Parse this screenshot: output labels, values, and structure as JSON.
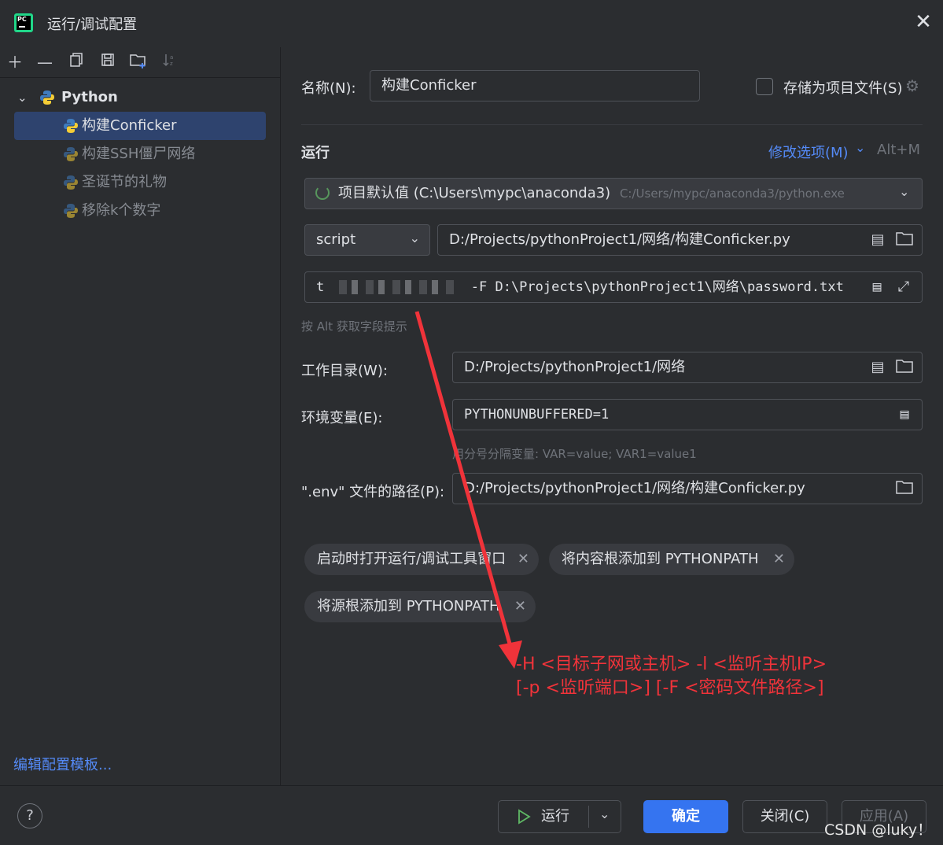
{
  "window": {
    "title": "运行/调试配置"
  },
  "tree": {
    "group": "Python",
    "items": [
      "构建Conficker",
      "构建SSH僵尸网络",
      "圣诞节的礼物",
      "移除k个数字"
    ]
  },
  "left_footer": {
    "edit_templates": "编辑配置模板..."
  },
  "form": {
    "name_label": "名称(N):",
    "name_value": "构建Conficker",
    "store_label": "存储为项目文件(S)",
    "run_section": "运行",
    "modify_options": "修改选项(M)",
    "modify_shortcut": "Alt+M",
    "interpreter_main": "项目默认值 (C:\\Users\\mypc\\anaconda3)",
    "interpreter_path": "C:/Users/mypc/anaconda3/python.exe",
    "script_type": "script",
    "script_path": "D:/Projects/pythonProject1/网络/构建Conficker.py",
    "params_prefix": "t",
    "params_value": "-F D:\\Projects\\pythonProject1\\网络\\password.txt",
    "alt_hint": "按 Alt 获取字段提示",
    "workdir_label": "工作目录(W):",
    "workdir_value": "D:/Projects/pythonProject1/网络",
    "env_label": "环境变量(E):",
    "env_value": "PYTHONUNBUFFERED=1",
    "env_hint": "用分号分隔变量: VAR=value; VAR1=value1",
    "dotenv_label": "\".env\" 文件的路径(P):",
    "dotenv_value": "D:/Projects/pythonProject1/网络/构建Conficker.py",
    "chips": [
      "启动时打开运行/调试工具窗口",
      "将内容根添加到 PYTHONPATH",
      "将源根添加到 PYTHONPATH"
    ]
  },
  "annotation": {
    "line1": "-H <目标子网或主机> -l <监听主机IP>",
    "line2": "[-p <监听端口>] [-F <密码文件路径>]",
    "color": "#f0333a"
  },
  "buttons": {
    "help": "?",
    "run": "运行",
    "ok": "确定",
    "close": "关闭(C)",
    "apply": "应用(A)"
  },
  "watermark": "CSDN @luky！",
  "colors": {
    "accent": "#3574f0",
    "selection": "#2e436e",
    "link": "#548af7"
  }
}
